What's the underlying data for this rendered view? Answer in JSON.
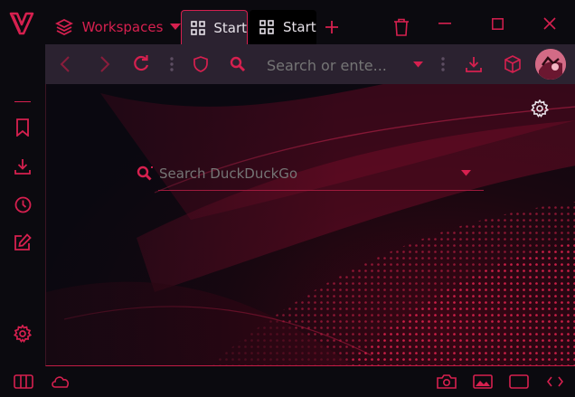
{
  "app": {
    "name": "Vivaldi"
  },
  "colors": {
    "accent": "#d6204f",
    "background": "#0b0a0f",
    "toolbar": "#2b2230",
    "text": "#e8e3ea"
  },
  "titlebar": {
    "workspaces_label": "Workspaces",
    "tabs": [
      {
        "label": "Start",
        "active": true,
        "icon": "speed-dial-grid-icon"
      },
      {
        "label": "Start",
        "active": false,
        "icon": "speed-dial-grid-icon"
      }
    ],
    "new_tab_icon": "plus-icon",
    "trash_icon": "trash-icon",
    "window_controls": [
      "minimize-icon",
      "maximize-icon",
      "close-icon"
    ]
  },
  "toolbar": {
    "address_placeholder": "Search or ente...",
    "buttons": [
      "back-icon",
      "forward-icon",
      "reload-icon",
      "shield-icon",
      "search-icon",
      "download-icon",
      "cube-icon",
      "profile-avatar"
    ]
  },
  "sidebar": {
    "items": [
      "bookmarks-icon",
      "downloads-icon",
      "history-icon",
      "notes-icon",
      "settings-icon"
    ]
  },
  "content": {
    "search_placeholder": "Search DuckDuckGo",
    "settings_icon": "gear-icon"
  },
  "statusbar": {
    "left": [
      "panel-toggle-icon",
      "sync-cloud-icon"
    ],
    "right": [
      "camera-icon",
      "image-icon",
      "window-icon",
      "code-icon"
    ]
  }
}
